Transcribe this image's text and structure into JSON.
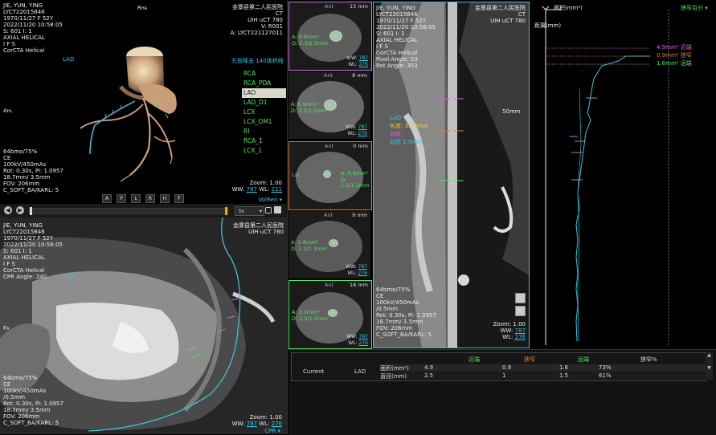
{
  "colors": {
    "cyan": "#33c6e6",
    "green": "#4fe65a",
    "yellow": "#f2d21a",
    "magenta": "#e35be3",
    "border_pink": "#c47bd6",
    "border_orange": "#e07a3c",
    "border_cyan": "#3fc3d6"
  },
  "vr": {
    "patient_name": "JIE, YUN, YING",
    "patient_id": "LYCT22015846",
    "dob": "1970/11/27 F 52Y",
    "date": "2022/11/20 10:58:05",
    "series": "S: 601 I: 1",
    "mode": "AXIAL HELICAL",
    "ifs": "I F S",
    "protocol": "CorCTA Helical",
    "hospital": "金寨县第二人民医院",
    "modality": "CT",
    "scanner": "UIH uCT 780",
    "vid": "V: R001",
    "acc": "A: LYCT221127011",
    "orient_top": "R",
    "orient_top_sub": "HA",
    "orient_left": "A",
    "orient_left_sub": "HL",
    "vessel_label": "LAD",
    "recon_title": "左前降支 140体积线",
    "vessels": [
      "RCA",
      "RCA_PDA",
      "LAD",
      "LAD_D1",
      "LCX",
      "LCX_OM1",
      "RI",
      "RCA_1",
      "LCX_1"
    ],
    "selected_vessel": "LAD",
    "tech": [
      "64bmo/75%",
      "CE",
      "100kV/450mAs",
      "Rot: 0.30s, Pi: 1.0957",
      "18.7mm/ 3.5mm",
      "FOV: 206mm",
      "C_SOFT_BA/KARL: 5"
    ],
    "zoom": "Zoom: 1.00",
    "ww_label": "WW:",
    "ww": "787",
    "wl_label": "WL:",
    "wl": "211",
    "view_buttons": [
      "A",
      "P",
      "L",
      "R",
      "H",
      "F"
    ],
    "render_mode": "VolRen"
  },
  "playbar": {
    "speed": "3x"
  },
  "cpr": {
    "patient_name": "JIE, YUN, YING",
    "patient_id": "LYCT22015846",
    "dob": "1970/11/27 F 52Y",
    "date": "2022/11/20 10:58:05",
    "series": "S: 601 I: 1",
    "mode": "AXIAL HELICAL",
    "ifs": "I F S",
    "protocol": "CorCTA Helical",
    "angle": "CPR Angle: 240",
    "hospital": "金寨县第二人民医院",
    "scanner": "UIH uCT 780",
    "vessel_label": "LAD",
    "orient": "F",
    "orient_sub": "A",
    "tech": [
      "64bmo/75%",
      "CE",
      "100kV/450mAs",
      "/0.5mm",
      "Rot: 0.30s, Pi: 1.0957",
      "18.7mm/ 3.5mm",
      "FOV: 206mm",
      "C_SOFT_BA/KARL: 5"
    ],
    "zoom": "Zoom: 1.00",
    "ww": "787",
    "wl": "276",
    "footer": "CPR"
  },
  "xsections": [
    {
      "dist": "15 mm",
      "orient": "Ant",
      "area": "A: 9.9mm²",
      "diam": "D: 2.3/2.5mm",
      "ww": "787",
      "wl": "276"
    },
    {
      "dist": "8 mm",
      "orient": "Ant",
      "area": "A: 6.9mm²",
      "diam": "D: 2.3/2.5mm",
      "ww": "787",
      "wl": "276"
    },
    {
      "dist": "0 mm",
      "orient": "Ant",
      "area": "A: 0.9mm²",
      "diam": "D: 1.1/1.1mm",
      "ww": "787",
      "wl": "276"
    },
    {
      "dist": "9 mm",
      "orient": "Ant",
      "area": "A: 1.8mm²",
      "diam": "D: 1.3/1.3mm",
      "ww": "787",
      "wl": "276"
    },
    {
      "dist": "16 mm",
      "orient": "Ant",
      "area": "A: 3.5mm²",
      "diam": "D: 1.5/1.5mm",
      "ww": "787",
      "wl": "276"
    }
  ],
  "straight": {
    "patient_name": "JIE, YUN, YING",
    "patient_id": "LYCT22015846",
    "dob": "1970/11/27 F 52Y",
    "date": "2022/11/20 10:58:05",
    "series": "S: 601 I: 1",
    "mode": "AXIAL HELICAL",
    "ifs": "I F S",
    "protocol": "CorCTA Helical",
    "sub1": "Pixel Angle: 53",
    "sub2": "Rot Angle: 353",
    "hospital": "金寨县第二人民医院",
    "modality": "CT",
    "scanner": "UIH uCT 780",
    "vessel_label": "LAD",
    "measure1": "长度: 33.9mm",
    "measure2": "前段",
    "measure3": "后段 1.5mm",
    "scale": "50mm",
    "tech": [
      "64bmo/75%",
      "CE",
      "100kV/450mAs",
      "/0.5mm",
      "Rot: 0.30s, Pi: 1.0957",
      "18.7mm/ 3.5mm",
      "FOV: 206mm",
      "C_SOFT_BA/KARL: 5"
    ],
    "zoom": "Zoom: 1.00",
    "ww": "787",
    "wl": "276"
  },
  "graph": {
    "x_label": "面积(mm²)",
    "y_label": "距离(mm)",
    "dropdown": "狭窄百分",
    "lines": [
      {
        "value": "4.9mm²",
        "label": "近端"
      },
      {
        "value": "0.9mm²",
        "label": "狭窄"
      },
      {
        "value": "1.6mm²",
        "label": "远端"
      }
    ]
  },
  "results": {
    "headers": [
      "近端",
      "狭窄",
      "远端",
      "狭窄%"
    ],
    "row_label": "Current",
    "vessel": "LAD",
    "rows": [
      {
        "name": "面积(mm²)",
        "values": [
          "4.9",
          "0.9",
          "1.6",
          "73%"
        ]
      },
      {
        "name": "直径(mm)",
        "values": [
          "2.5",
          "1",
          "1.5",
          "61%"
        ]
      }
    ]
  }
}
